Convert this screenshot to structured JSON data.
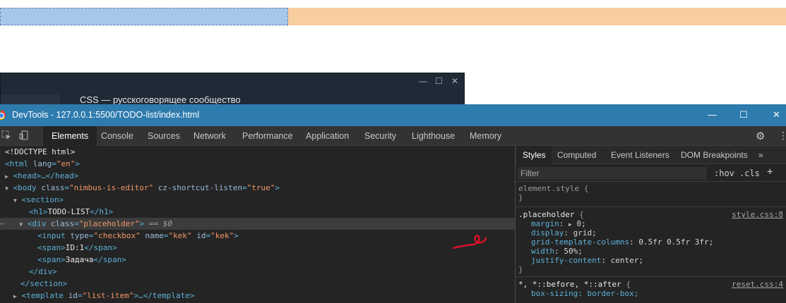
{
  "bg_window": {
    "title": "CSS — русскоговорящее сообщество",
    "min": "—",
    "max": "☐",
    "close": "✕"
  },
  "devtools": {
    "title": "DevTools - 127.0.0.1:5500/TODO-list/index.html",
    "min": "—",
    "max": "☐",
    "close": "✕",
    "tabs": [
      "Elements",
      "Console",
      "Sources",
      "Network",
      "Performance",
      "Application",
      "Security",
      "Lighthouse",
      "Memory"
    ]
  },
  "dom": {
    "doctype": "<!DOCTYPE html>",
    "html_tag": "html",
    "html_attr": "lang",
    "html_val": "\"en\"",
    "head": "<head>…</head>",
    "body_tag": "body",
    "body_attr1": "class",
    "body_val1": "\"nimbus-is-editor\"",
    "body_attr2": "cz-shortcut-listen",
    "body_val2": "\"true\"",
    "section_open": "<section>",
    "h1_open": "<h1>",
    "h1_text": "TODO-LIST",
    "h1_close": "</h1>",
    "div_tag": "div",
    "div_attr": "class",
    "div_val": "\"placeholder\"",
    "div_eq": "== $0",
    "input_tag": "input",
    "input_a1": "type",
    "input_v1": "\"checkbox\"",
    "input_a2": "name",
    "input_v2": "\"kek\"",
    "input_a3": "id",
    "input_v3": "\"kek\"",
    "span_open": "<span>",
    "span_close": "</span>",
    "span1_text": "ID:1",
    "span2_text": "Задача",
    "div_close": "</div>",
    "section_close": "</section>",
    "template_tag": "template",
    "template_attr": "id",
    "template_val": "\"list-item\"",
    "template_rest": ">…</template>"
  },
  "styles": {
    "tabs": [
      "Styles",
      "Computed",
      "Event Listeners",
      "DOM Breakpoints"
    ],
    "more": "»",
    "filter_placeholder": "Filter",
    "hov": ":hov",
    "cls": ".cls",
    "plus": "+",
    "element_style": "element.style {",
    "close_brace": "}",
    "rule1_selector": ".placeholder",
    "rule1_src": "style.css:8",
    "rule1_props": [
      {
        "name": "margin",
        "value": "0;",
        "expander": "▶"
      },
      {
        "name": "display",
        "value": "grid;"
      },
      {
        "name": "grid-template-columns",
        "value": "0.5fr 0.5fr 3fr;"
      },
      {
        "name": "width",
        "value": "50%;"
      },
      {
        "name": "justify-content",
        "value": "center;"
      }
    ],
    "rule2_selector": "*, *::before, *::after",
    "rule2_src": "reset.css:4",
    "rule2_prop": "box-sizing: border-box;"
  },
  "colors": {
    "titlebar": "#2e7bae",
    "panel_bg": "#242424",
    "tag": "#5db0d7",
    "attr_value": "#f29766",
    "annotation": "#e0102a"
  }
}
